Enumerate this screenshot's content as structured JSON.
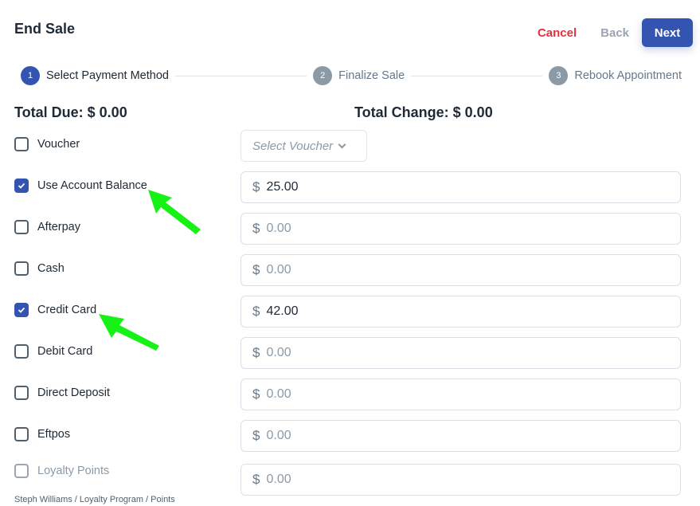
{
  "header": {
    "title": "End Sale",
    "cancel_label": "Cancel",
    "back_label": "Back",
    "next_label": "Next"
  },
  "stepper": {
    "steps": [
      {
        "number": "1",
        "label": "Select Payment Method",
        "state": "active"
      },
      {
        "number": "2",
        "label": "Finalize Sale",
        "state": "inactive"
      },
      {
        "number": "3",
        "label": "Rebook Appointment",
        "state": "inactive"
      }
    ]
  },
  "totals": {
    "due": "Total Due: $ 0.00",
    "change": "Total Change: $ 0.00"
  },
  "voucher": {
    "label": "Voucher",
    "checked": false,
    "select_placeholder": "Select Voucher"
  },
  "payment_methods": [
    {
      "label": "Use Account Balance",
      "checked": true,
      "currency": "$",
      "value": "25.00",
      "placeholder": false
    },
    {
      "label": "Afterpay",
      "checked": false,
      "currency": "$",
      "value": "0.00",
      "placeholder": true
    },
    {
      "label": "Cash",
      "checked": false,
      "currency": "$",
      "value": "0.00",
      "placeholder": true
    },
    {
      "label": "Credit Card",
      "checked": true,
      "currency": "$",
      "value": "42.00",
      "placeholder": false
    },
    {
      "label": "Debit Card",
      "checked": false,
      "currency": "$",
      "value": "0.00",
      "placeholder": true
    },
    {
      "label": "Direct Deposit",
      "checked": false,
      "currency": "$",
      "value": "0.00",
      "placeholder": true
    },
    {
      "label": "Eftpos",
      "checked": false,
      "currency": "$",
      "value": "0.00",
      "placeholder": true
    },
    {
      "label": "Loyalty Points",
      "checked": false,
      "disabled": true,
      "currency": "$",
      "value": "0.00",
      "placeholder": true
    }
  ],
  "loyalty_breadcrumb": "Steph Williams / Loyalty Program / Points",
  "annotation_color": "#16f216"
}
